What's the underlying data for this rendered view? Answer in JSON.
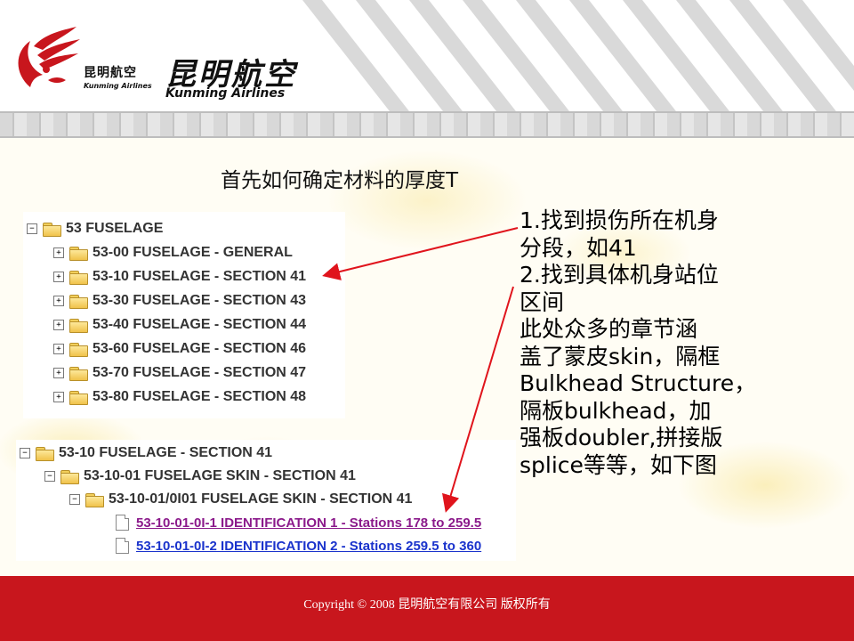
{
  "brand": {
    "small_cn": "昆明航空",
    "small_en": "Kunming Airlines",
    "big_cn": "昆明航空",
    "big_en": "Kunming Airlines"
  },
  "title": "首先如何确定材料的厚度T",
  "tree1": {
    "rows": [
      {
        "expander": "−",
        "label": "53 FUSELAGE"
      },
      {
        "expander": "+",
        "label": "53-00 FUSELAGE - GENERAL"
      },
      {
        "expander": "+",
        "label": "53-10 FUSELAGE - SECTION 41"
      },
      {
        "expander": "+",
        "label": "53-30 FUSELAGE - SECTION 43"
      },
      {
        "expander": "+",
        "label": "53-40 FUSELAGE - SECTION 44"
      },
      {
        "expander": "+",
        "label": "53-60 FUSELAGE - SECTION 46"
      },
      {
        "expander": "+",
        "label": "53-70 FUSELAGE - SECTION 47"
      },
      {
        "expander": "+",
        "label": "53-80 FUSELAGE - SECTION 48"
      }
    ]
  },
  "tree2": {
    "rows": [
      {
        "expander": "−",
        "label": "53-10 FUSELAGE - SECTION 41"
      },
      {
        "expander": "−",
        "label": "53-10-01 FUSELAGE SKIN - SECTION 41"
      },
      {
        "expander": "−",
        "label": "53-10-01/0I01 FUSELAGE SKIN - SECTION 41"
      }
    ],
    "links": [
      {
        "label": "53-10-01-0I-1 IDENTIFICATION 1 - Stations 178 to 259.5",
        "color": "#8b1a8b"
      },
      {
        "label": "53-10-01-0I-2 IDENTIFICATION 2 - Stations 259.5 to 360",
        "color": "#1a33cc"
      }
    ]
  },
  "notes": [
    "1.找到损伤所在机身",
    "分段，如41",
    "2.找到具体机身站位",
    "区间",
    "此处众多的章节涵",
    "盖了蒙皮skin，隔框",
    "Bulkhead Structure，",
    "隔板bulkhead，加",
    "强板doubler,拼接版",
    "splice等等，如下图"
  ],
  "footer": {
    "copyright": "Copyright  © 2008 昆明航空有限公司  版权所有"
  },
  "colors": {
    "brand_red": "#c8161d",
    "arrow_red": "#e0141c"
  }
}
